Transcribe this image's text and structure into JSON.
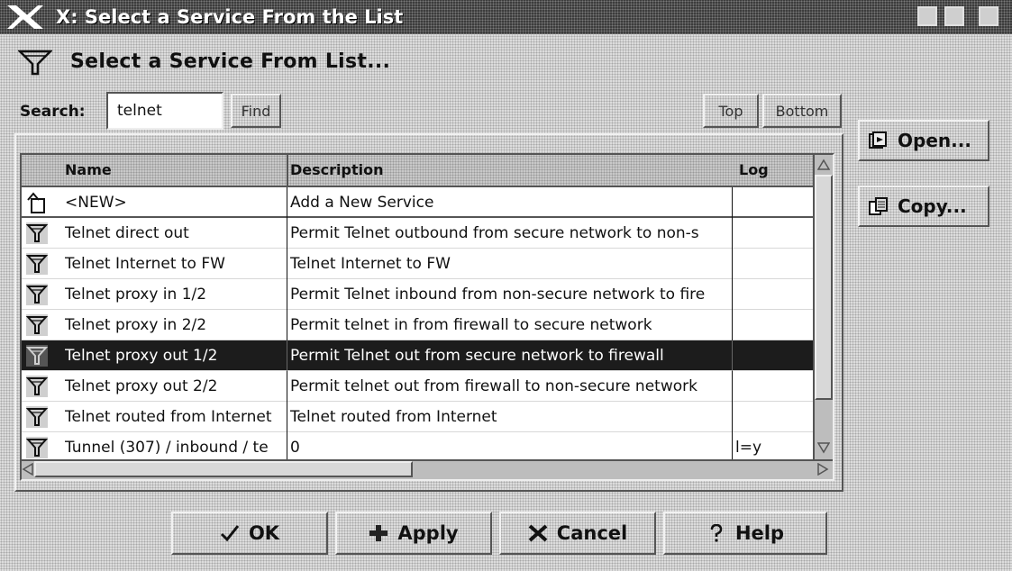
{
  "window": {
    "title": "X: Select a Service From the List",
    "logo_icon": "x-logo-icon"
  },
  "heading": "Select a Service From List...",
  "search": {
    "label": "Search:",
    "value": "telnet",
    "find_label": "Find"
  },
  "nav": {
    "top_label": "Top",
    "bottom_label": "Bottom"
  },
  "side_buttons": {
    "open_label": "Open...",
    "copy_label": "Copy..."
  },
  "list": {
    "columns": [
      "Name",
      "Description",
      "Log"
    ],
    "rows": [
      {
        "icon": "new-item-icon",
        "name": "<NEW>",
        "description": "Add a New Service",
        "log": ""
      },
      {
        "icon": "filter-icon",
        "name": "Telnet direct out",
        "description": "Permit Telnet outbound from secure network to non-s",
        "log": ""
      },
      {
        "icon": "filter-icon",
        "name": "Telnet Internet to FW",
        "description": "Telnet Internet to FW",
        "log": ""
      },
      {
        "icon": "filter-icon",
        "name": "Telnet proxy in 1/2",
        "description": "Permit Telnet inbound from non-secure network to fire",
        "log": ""
      },
      {
        "icon": "filter-icon",
        "name": "Telnet proxy in 2/2",
        "description": "Permit telnet in from firewall to secure network",
        "log": ""
      },
      {
        "icon": "filter-icon",
        "name": "Telnet proxy out 1/2",
        "description": "Permit Telnet out from secure network to firewall",
        "log": "",
        "selected": true
      },
      {
        "icon": "filter-icon",
        "name": "Telnet proxy out 2/2",
        "description": "Permit telnet out from firewall to non-secure network",
        "log": ""
      },
      {
        "icon": "filter-icon",
        "name": "Telnet routed from Internet",
        "description": "Telnet routed from Internet",
        "log": ""
      },
      {
        "icon": "filter-icon",
        "name": "Tunnel (307) / inbound / te",
        "description": "0",
        "log": "l=y"
      }
    ]
  },
  "buttons": {
    "ok_label": "OK",
    "apply_label": "Apply",
    "cancel_label": "Cancel",
    "help_label": "Help"
  }
}
